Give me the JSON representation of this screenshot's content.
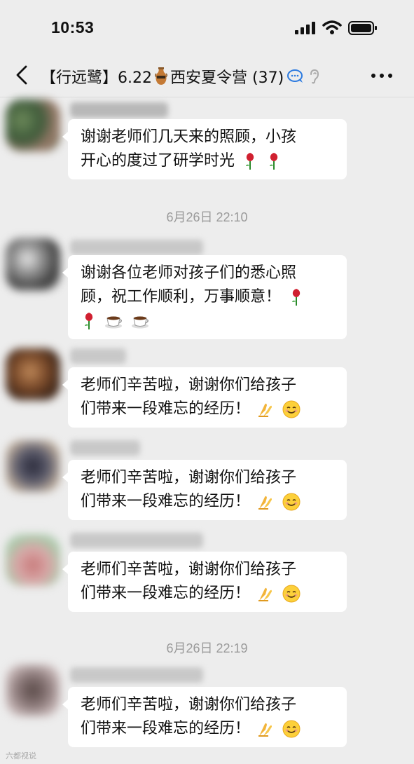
{
  "status": {
    "time": "10:53"
  },
  "chat": {
    "title": "【行远鹭】6.22",
    "title_rest": "西安夏令营 (37)"
  },
  "icons": [
    "back-icon",
    "amphora-icon",
    "chat-bubbles-icon",
    "ear-icon",
    "more-icon",
    "rose-icon",
    "coffee-icon",
    "folded-hands-icon",
    "smile-icon",
    "signal-icon",
    "wifi-icon",
    "battery-icon"
  ],
  "timestamps": {
    "t1": "6月26日 22:10",
    "t2": "6月26日 22:19"
  },
  "messages": [
    {
      "line1": "谢谢老师们几天来的照顾，小孩",
      "line2": "开心的度过了研学时光"
    },
    {
      "line1": "谢谢各位老师对孩子们的悉心照",
      "line2": "顾，祝工作顺利，万事顺意！"
    },
    {
      "line1": "老师们辛苦啦，谢谢你们给孩子",
      "line2": "们带来一段难忘的经历！"
    },
    {
      "line1": "老师们辛苦啦，谢谢你们给孩子",
      "line2": "们带来一段难忘的经历！"
    },
    {
      "line1": "老师们辛苦啦，谢谢你们给孩子",
      "line2": "们带来一段难忘的经历！"
    },
    {
      "line1": "老师们辛苦啦，谢谢你们给孩子",
      "line2": "们带来一段难忘的经历！"
    }
  ],
  "watermark": "六都视说",
  "colors": {
    "background": "#ededed",
    "bubble": "#ffffff",
    "timestamp": "#9a9a9a"
  }
}
